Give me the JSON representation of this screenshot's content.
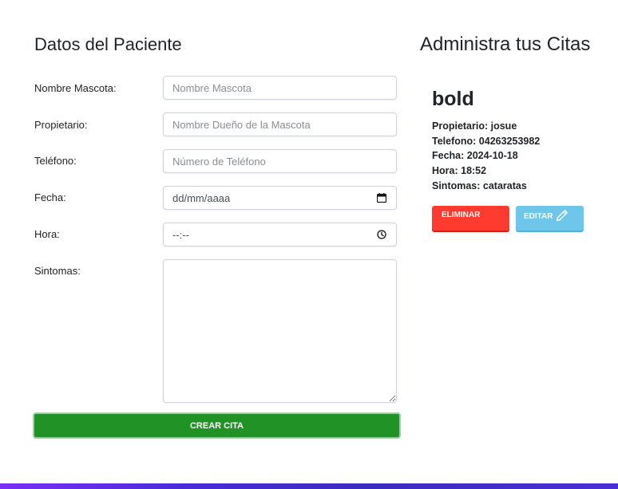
{
  "form": {
    "title": "Datos del Paciente",
    "fields": [
      {
        "label": "Nombre Mascota:",
        "placeholder": "Nombre Mascota"
      },
      {
        "label": "Propietario:",
        "placeholder": "Nombre Dueño de la Mascota"
      },
      {
        "label": "Teléfono:",
        "placeholder": "Número de Teléfono"
      },
      {
        "label": "Fecha:",
        "display_value": "dd/mm/aaaa",
        "icon": "calendar-icon"
      },
      {
        "label": "Hora:",
        "display_value": "--:--",
        "icon": "clock-icon"
      },
      {
        "label": "Sintomas:",
        "placeholder": ""
      }
    ],
    "submit_label": "CREAR CITA"
  },
  "list": {
    "title": "Administra tus Citas",
    "citas": [
      {
        "pet": "bold",
        "lines": [
          "Propietario: josue",
          "Telefono: 04263253982",
          "Fecha: 2024-10-18",
          "Hora: 18:52",
          "Sintomas: cataratas"
        ],
        "delete_label": "ELIMINAR",
        "edit_label": "EDITAR",
        "edit_icon": "pencil-icon"
      }
    ]
  },
  "colors": {
    "submit": "#219326",
    "delete": "#ff3b30",
    "edit": "#6ec6ea"
  }
}
